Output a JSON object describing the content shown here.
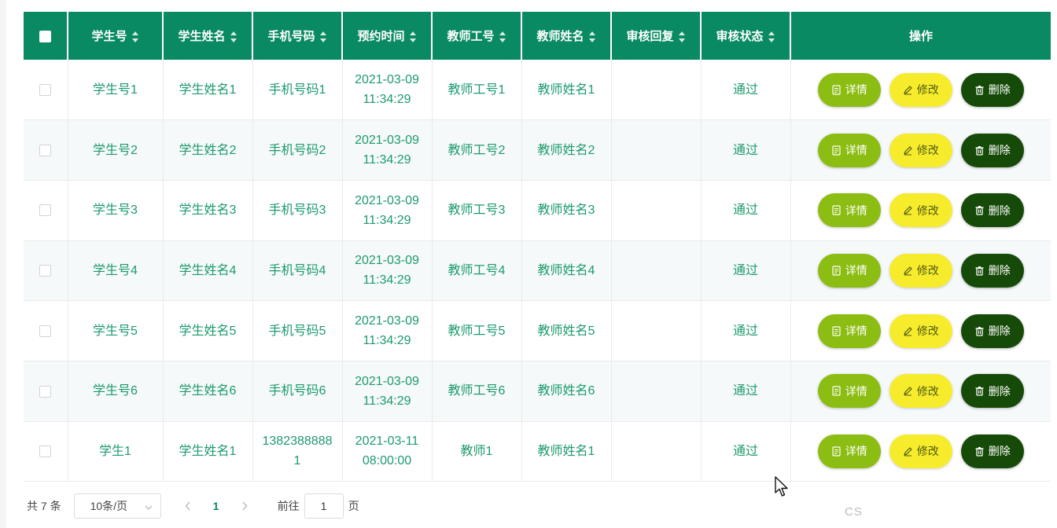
{
  "table": {
    "headers": [
      {
        "label": "",
        "sortable": false,
        "type": "checkbox"
      },
      {
        "label": "学生号",
        "sortable": true
      },
      {
        "label": "学生姓名",
        "sortable": true
      },
      {
        "label": "手机号码",
        "sortable": true
      },
      {
        "label": "预约时间",
        "sortable": true
      },
      {
        "label": "教师工号",
        "sortable": true
      },
      {
        "label": "教师姓名",
        "sortable": true
      },
      {
        "label": "审核回复",
        "sortable": true
      },
      {
        "label": "审核状态",
        "sortable": true
      },
      {
        "label": "操作",
        "sortable": false
      }
    ],
    "rows": [
      {
        "student_id": "学生号1",
        "student_name": "学生姓名1",
        "phone": "手机号码1",
        "time_date": "2021-03-09",
        "time_clock": "11:34:29",
        "teacher_id": "教师工号1",
        "teacher_name": "教师姓名1",
        "reply": "",
        "status": "通过"
      },
      {
        "student_id": "学生号2",
        "student_name": "学生姓名2",
        "phone": "手机号码2",
        "time_date": "2021-03-09",
        "time_clock": "11:34:29",
        "teacher_id": "教师工号2",
        "teacher_name": "教师姓名2",
        "reply": "",
        "status": "通过"
      },
      {
        "student_id": "学生号3",
        "student_name": "学生姓名3",
        "phone": "手机号码3",
        "time_date": "2021-03-09",
        "time_clock": "11:34:29",
        "teacher_id": "教师工号3",
        "teacher_name": "教师姓名3",
        "reply": "",
        "status": "通过"
      },
      {
        "student_id": "学生号4",
        "student_name": "学生姓名4",
        "phone": "手机号码4",
        "time_date": "2021-03-09",
        "time_clock": "11:34:29",
        "teacher_id": "教师工号4",
        "teacher_name": "教师姓名4",
        "reply": "",
        "status": "通过"
      },
      {
        "student_id": "学生号5",
        "student_name": "学生姓名5",
        "phone": "手机号码5",
        "time_date": "2021-03-09",
        "time_clock": "11:34:29",
        "teacher_id": "教师工号5",
        "teacher_name": "教师姓名5",
        "reply": "",
        "status": "通过"
      },
      {
        "student_id": "学生号6",
        "student_name": "学生姓名6",
        "phone": "手机号码6",
        "time_date": "2021-03-09",
        "time_clock": "11:34:29",
        "teacher_id": "教师工号6",
        "teacher_name": "教师姓名6",
        "reply": "",
        "status": "通过"
      },
      {
        "student_id": "学生1",
        "student_name": "学生姓名1",
        "phone": "13823888881",
        "time_date": "2021-03-11",
        "time_clock": "08:00:00",
        "teacher_id": "教师1",
        "teacher_name": "教师姓名1",
        "reply": "",
        "status": "通过"
      }
    ],
    "actions": {
      "detail": "详情",
      "edit": "修改",
      "delete": "删除"
    }
  },
  "pager": {
    "total": "共 7 条",
    "page_size": "10条/页",
    "current_page": "1",
    "goto_label": "前往",
    "goto_value": "1",
    "page_unit": "页"
  },
  "watermark": "CS",
  "colors": {
    "header_bg": "#0a8a62",
    "cell_text": "#1d9a6c",
    "detail_btn": "#8cbd12",
    "edit_btn": "#f7ec2c",
    "delete_btn": "#164a08"
  },
  "icons": {
    "detail": "document-icon",
    "edit": "pencil-icon",
    "delete": "trash-icon",
    "sort": "sort-caret-icon",
    "prev": "chevron-left-icon",
    "next": "chevron-right-icon",
    "dropdown": "chevron-down-icon"
  }
}
